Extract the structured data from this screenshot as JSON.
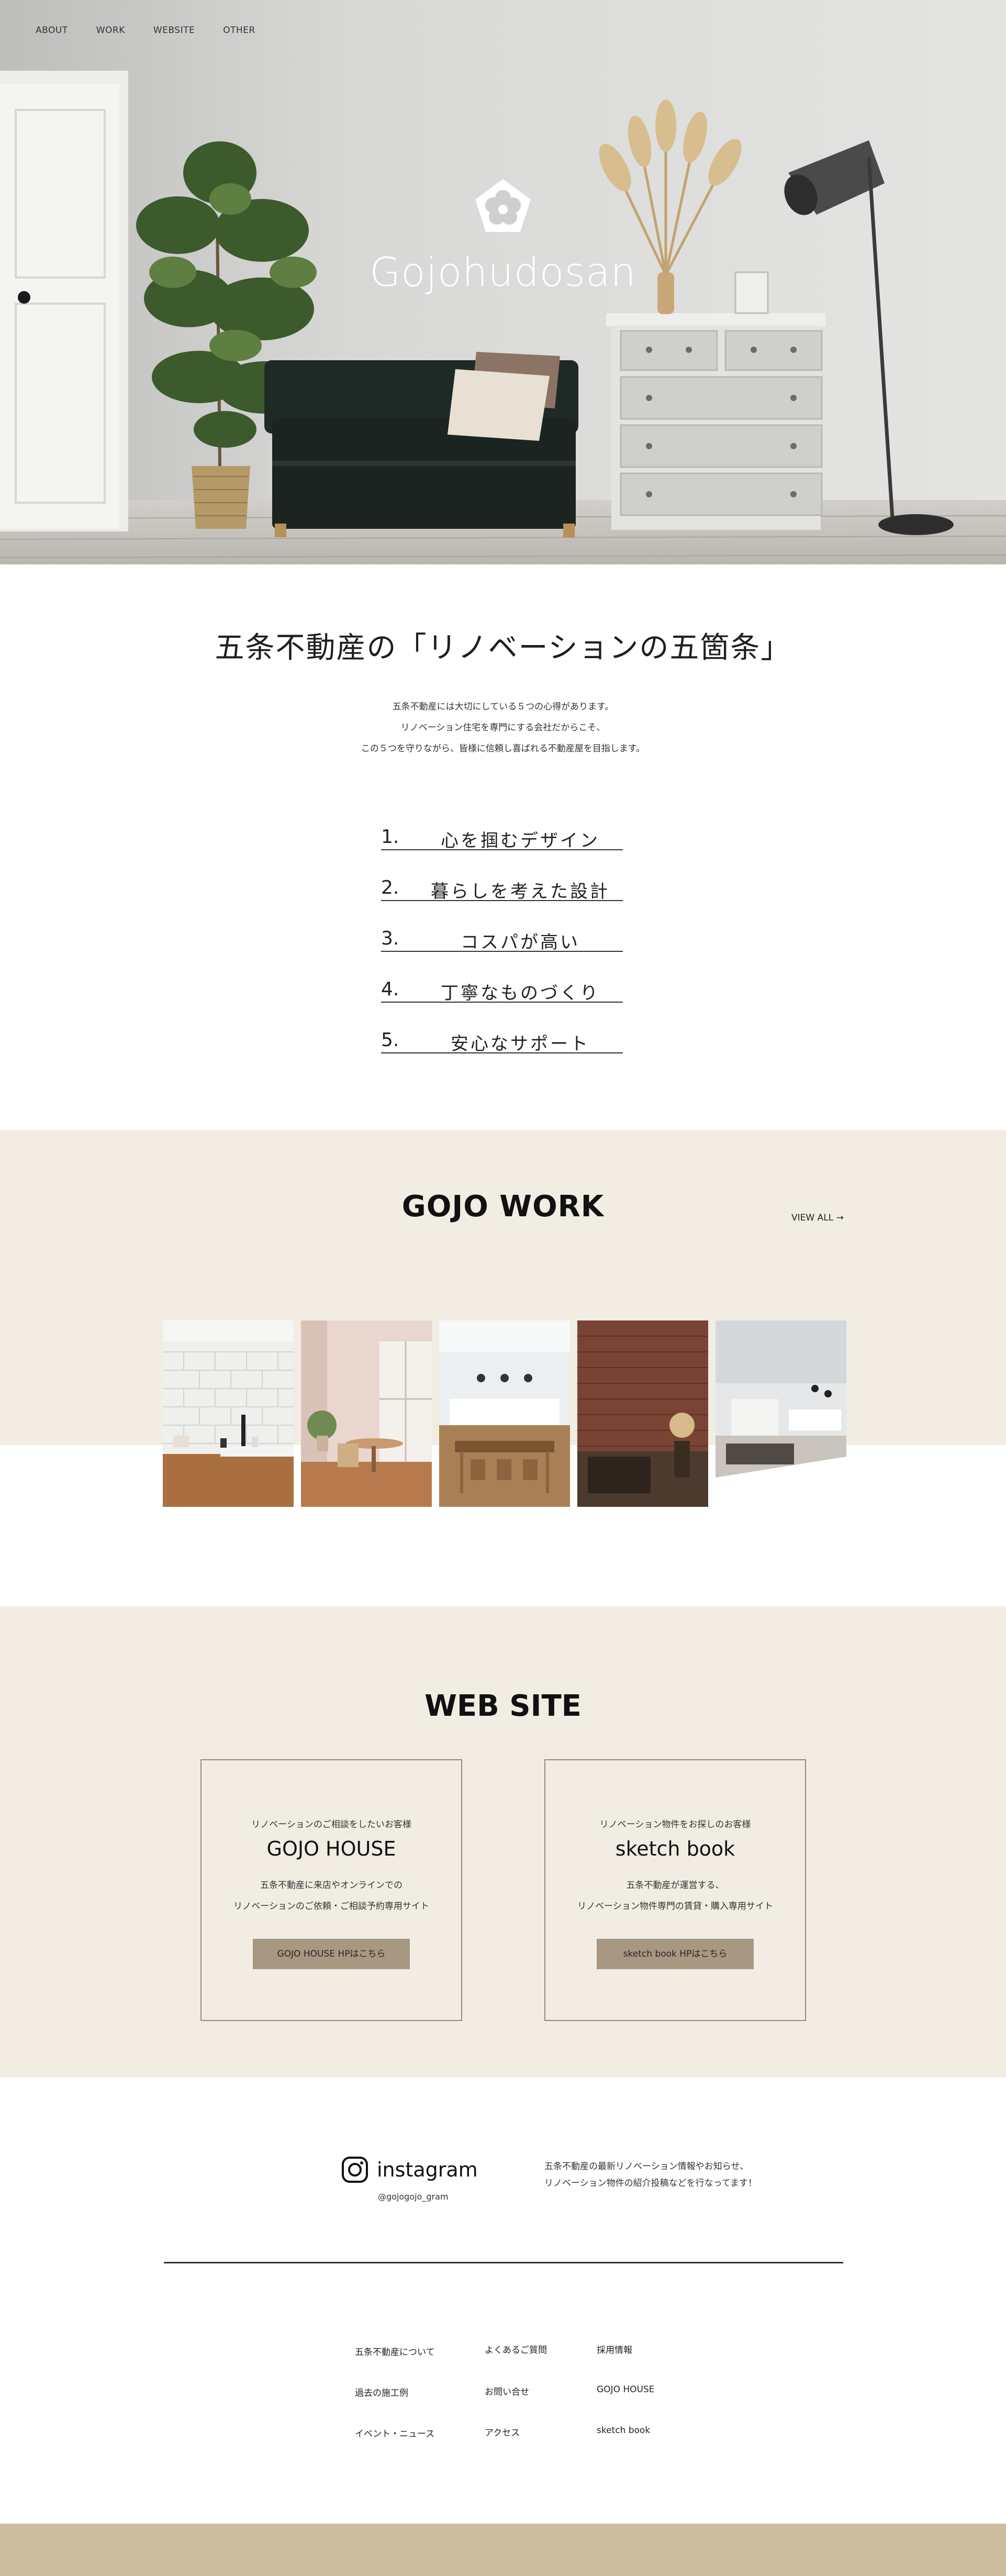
{
  "nav": {
    "items": [
      {
        "label": "ABOUT"
      },
      {
        "label": "WORK"
      },
      {
        "label": "WEBSITE"
      },
      {
        "label": "OTHER"
      }
    ]
  },
  "hero": {
    "logo_text": "Gojohudosan",
    "logo_icon": "pentagon-flower-icon"
  },
  "intro": {
    "title": "五条不動産の「リノベーションの五箇条」",
    "lines": [
      "五条不動産には大切にしている５つの心得があります。",
      "リノベーション住宅を専門にする会社だからこそ、",
      "この５つを守りながら、皆様に信頼し喜ばれる不動産屋を目指します。"
    ],
    "rules": [
      {
        "num": "1.",
        "text": "心を掴むデザイン"
      },
      {
        "num": "2.",
        "text": "暮らしを考えた設計"
      },
      {
        "num": "3.",
        "text": "コスパが高い"
      },
      {
        "num": "4.",
        "text": "丁寧なものづくり"
      },
      {
        "num": "5.",
        "text": "安心なサポート"
      }
    ]
  },
  "work": {
    "title": "GOJO WORK",
    "view_all": "VIEW ALL →"
  },
  "website": {
    "title": "WEB SITE",
    "cards": [
      {
        "sub": "リノベーションのご相談をしたいお客様",
        "name": "GOJO HOUSE",
        "desc1": "五条不動産に来店やオンラインでの",
        "desc2": "リノベーションのご依頼・ご相談予約専用サイト",
        "button": "GOJO HOUSE HPはこちら"
      },
      {
        "sub": "リノベーション物件をお探しのお客様",
        "name": "sketch book",
        "desc1": "五条不動産が運営する、",
        "desc2": "リノベーション物件専門の賃貸・購入専用サイト",
        "button": "sketch book HPはこちら"
      }
    ]
  },
  "instagram": {
    "label": "instagram",
    "handle": "@gojogojo_gram",
    "text1": "五条不動産の最新リノベーション情報やお知らせ、",
    "text2": "リノベーション物件の紹介投稿などを行なってます！"
  },
  "footer": {
    "col1": [
      "五条不動産について",
      "過去の施工例",
      "イベント・ニュース"
    ],
    "col2": [
      "よくあるご質問",
      "お問い合せ",
      "アクセス"
    ],
    "col3": [
      "採用情報",
      "GOJO HOUSE",
      "sketch book"
    ]
  },
  "colors": {
    "beige_bg": "#f1ede3",
    "button": "#a89781",
    "bottom_band": "#cdbd9f"
  }
}
